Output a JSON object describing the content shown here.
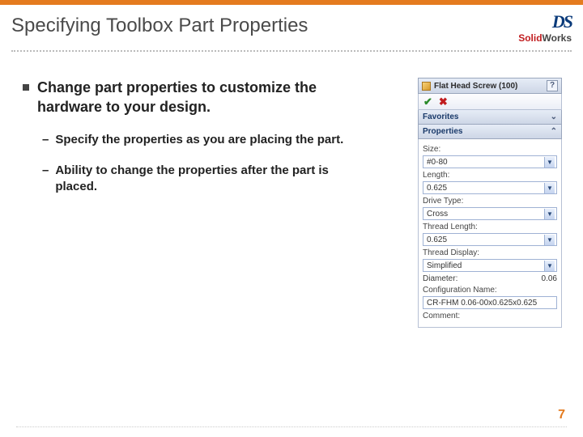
{
  "slide": {
    "title": "Specifying Toolbox Part Properties",
    "page_number": "7"
  },
  "logo": {
    "ds": "DS",
    "solid": "Solid",
    "works": "Works"
  },
  "bullets": {
    "main": "Change part properties to customize the hardware to your design.",
    "sub1": "Specify the properties as you are placing the part.",
    "sub2": "Ability to change the properties after the part is placed."
  },
  "panel": {
    "header_title": "Flat Head Screw (100)",
    "help": "?",
    "favorites_label": "Favorites",
    "properties_label": "Properties",
    "fields": {
      "size_label": "Size:",
      "size_value": "#0-80",
      "length_label": "Length:",
      "length_value": "0.625",
      "drive_label": "Drive Type:",
      "drive_value": "Cross",
      "thread_len_label": "Thread Length:",
      "thread_len_value": "0.625",
      "thread_disp_label": "Thread Display:",
      "thread_disp_value": "Simplified",
      "diameter_label": "Diameter:",
      "diameter_value": "0.06",
      "config_label": "Configuration Name:",
      "config_value": "CR-FHM 0.06-00x0.625x0.625",
      "comment_label": "Comment:"
    }
  }
}
